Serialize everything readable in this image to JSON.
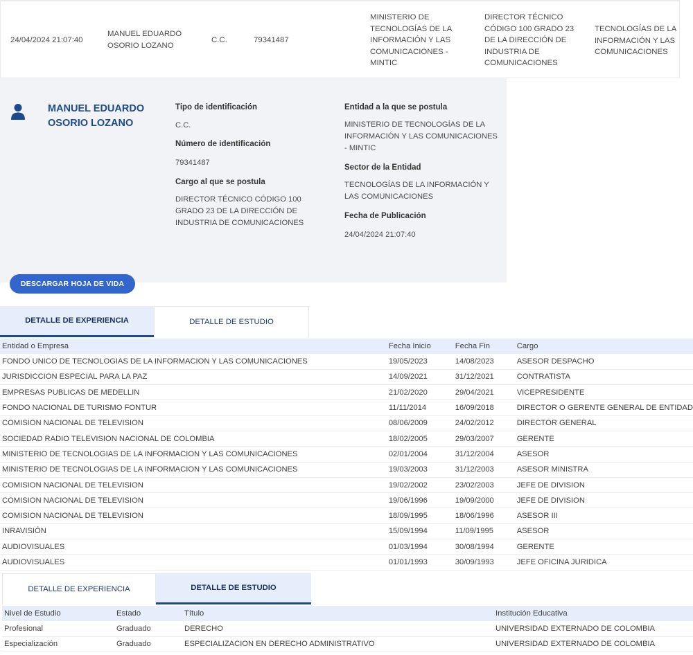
{
  "summary_row": {
    "fecha": "24/04/2024 21:07:40",
    "nombre": "MANUEL EDUARDO OSORIO LOZANO",
    "tipo_id": "C.C.",
    "numero_id": "79341487",
    "entidad": "MINISTERIO DE TECNOLOGÍAS DE LA INFORMACIÓN Y LAS COMUNICACIONES - MINTIC",
    "cargo": "DIRECTOR TÉCNICO CÓDIGO 100 GRADO 23 DE LA DIRECCIÓN DE INDUSTRIA DE COMUNICACIONES",
    "sector": "TECNOLOGÍAS DE LA INFORMACIÓN Y LAS COMUNICACIONES"
  },
  "profile": {
    "name": "MANUEL EDUARDO OSORIO LOZANO",
    "tipo_id_label": "Tipo de identificación",
    "tipo_id_value": "C.C.",
    "numero_id_label": "Número de identificación",
    "numero_id_value": "79341487",
    "cargo_label": "Cargo al que se postula",
    "cargo_value": "DIRECTOR TÉCNICO CÓDIGO 100 GRADO 23 DE LA DIRECCIÓN DE INDUSTRIA DE COMUNICACIONES",
    "entidad_label": "Entidad a la que se postula",
    "entidad_value": "MINISTERIO DE TECNOLOGÍAS DE LA INFORMACIÓN Y LAS COMUNICACIONES - MINTIC",
    "sector_label": "Sector de la Entidad",
    "sector_value": "TECNOLOGÍAS DE LA INFORMACIÓN Y LAS COMUNICACIONES",
    "fecha_label": "Fecha de Publicación",
    "fecha_value": "24/04/2024 21:07:40",
    "icon": "person-icon"
  },
  "download_button": "DESCARGAR HOJA DE VIDA",
  "tabs": {
    "experiencia": "DETALLE DE EXPERIENCIA",
    "estudio": "DETALLE DE ESTUDIO"
  },
  "experience": {
    "headers": [
      "Entidad o Empresa",
      "Fecha Inicio",
      "Fecha Fin",
      "Cargo"
    ],
    "rows": [
      [
        "FONDO UNICO DE TECNOLOGIAS DE LA INFORMACION Y LAS COMUNICACIONES",
        "19/05/2023",
        "14/08/2023",
        "ASESOR DESPACHO"
      ],
      [
        "JURISDICCION ESPECIAL PARA LA PAZ",
        "14/09/2021",
        "31/12/2021",
        "CONTRATISTA"
      ],
      [
        "EMPRESAS PUBLICAS DE MEDELLIN",
        "21/02/2020",
        "29/04/2021",
        "VICEPRESIDENTE"
      ],
      [
        "FONDO NACIONAL DE TURISMO FONTUR",
        "11/11/2014",
        "16/09/2018",
        "DIRECTOR O GERENTE GENERAL DE ENTIDAD"
      ],
      [
        "COMISION NACIONAL DE TELEVISION",
        "08/06/2009",
        "24/02/2012",
        "DIRECTOR GENERAL"
      ],
      [
        "SOCIEDAD RADIO TELEVISION NACIONAL DE COLOMBIA",
        "18/02/2005",
        "29/03/2007",
        "GERENTE"
      ],
      [
        "MINISTERIO DE TECNOLOGIAS DE LA INFORMACION Y LAS COMUNICACIONES",
        "02/01/2004",
        "31/12/2004",
        "ASESOR"
      ],
      [
        "MINISTERIO DE TECNOLOGIAS DE LA INFORMACION Y LAS COMUNICACIONES",
        "19/03/2003",
        "31/12/2003",
        "ASESOR MINISTRA"
      ],
      [
        "COMISION NACIONAL DE TELEVISION",
        "19/02/2002",
        "23/02/2003",
        "JEFE DE DIVISION"
      ],
      [
        "COMISION NACIONAL DE TELEVISION",
        "19/06/1996",
        "19/09/2000",
        "JEFE DE DIVISION"
      ],
      [
        "COMISION NACIONAL DE TELEVISION",
        "18/09/1995",
        "18/06/1996",
        "ASESOR III"
      ],
      [
        "INRAVISIÓN",
        "15/09/1994",
        "11/09/1995",
        "ASESOR"
      ],
      [
        "AUDIOVISUALES",
        "01/03/1994",
        "30/08/1994",
        "GERENTE"
      ],
      [
        "AUDIOVISUALES",
        "01/01/1993",
        "30/09/1993",
        "JEFE OFICINA JURIDICA"
      ]
    ]
  },
  "study": {
    "headers": [
      "Nivel de Estudio",
      "Estado",
      "Título",
      "Institución Educativa"
    ],
    "rows": [
      [
        "Profesional",
        "Graduado",
        "DERECHO",
        "UNIVERSIDAD EXTERNADO DE COLOMBIA"
      ],
      [
        "Especialización",
        "Graduado",
        "ESPECIALIZACION EN DERECHO ADMINISTRATIVO",
        "UNIVERSIDAD EXTERNADO DE COLOMBIA"
      ]
    ]
  },
  "colors": {
    "accent": "#1d4a8c",
    "button": "#3366cc",
    "panel": "#f1f3f6",
    "header_bg": "#e6eefb"
  }
}
